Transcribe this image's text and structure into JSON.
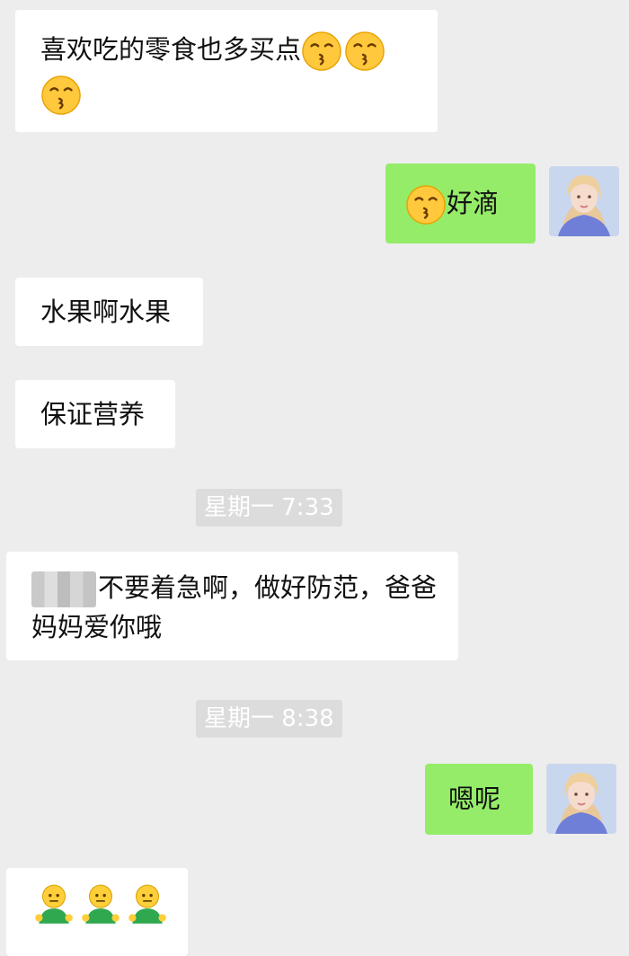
{
  "messages": {
    "m1_text": "喜欢吃的零食也多买点",
    "m2_text": "好滴",
    "m3_text": "水果啊水果",
    "m4_text": "保证营养",
    "m5_text": "不要着急啊，做好防范，爸爸妈妈爱你哦",
    "m6_text": "嗯呢"
  },
  "timestamps": {
    "t1": "星期一 7:33",
    "t2": "星期一 8:38"
  },
  "icons": {
    "kiss": "kissing-face-icon",
    "hunch": "person-emoji-icon"
  },
  "colors": {
    "background": "#ededed",
    "self_bubble": "#95ec69",
    "other_bubble": "#ffffff"
  }
}
